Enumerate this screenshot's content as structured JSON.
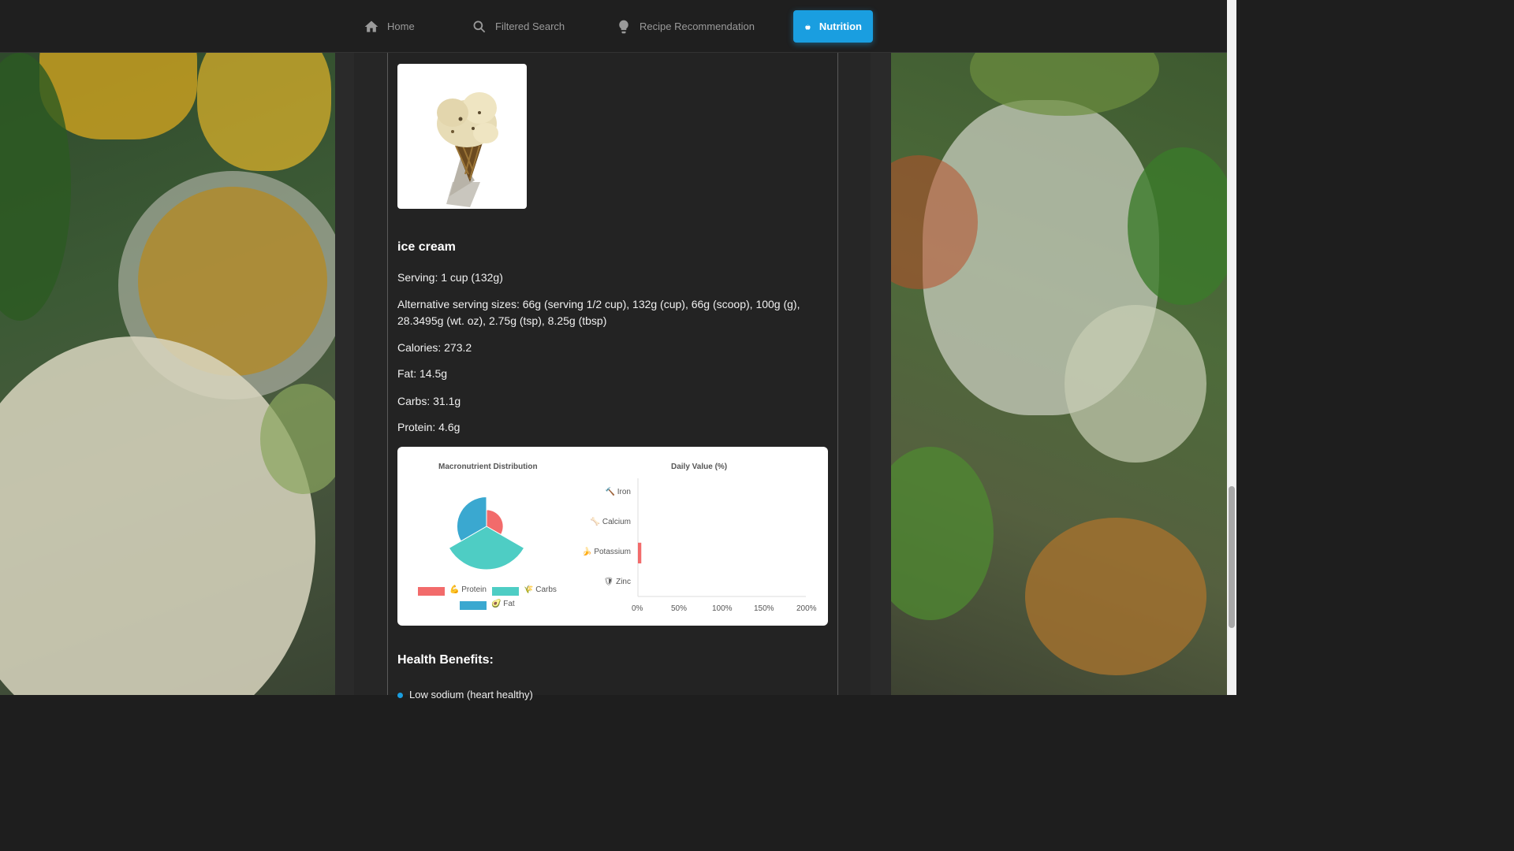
{
  "nav": {
    "items": [
      {
        "label": "Home",
        "icon": "home-icon"
      },
      {
        "label": "Filtered Search",
        "icon": "search-icon"
      },
      {
        "label": "Recipe Recommendation",
        "icon": "lightbulb-icon"
      },
      {
        "label": "Nutrition",
        "icon": "apple-icon",
        "active": true
      }
    ],
    "accent": "#1a9ee0"
  },
  "food": {
    "name": "ice cream",
    "serving": "Serving: 1 cup (132g)",
    "alternative": "Alternative serving sizes: 66g (serving 1/2 cup), 132g (cup), 66g (scoop), 100g (g), 28.3495g (wt. oz), 2.75g (tsp), 8.25g (tbsp)",
    "calories": "Calories: 273.2",
    "fat": "Fat: 14.5g",
    "carbs": "Carbs: 31.1g",
    "protein": "Protein: 4.6g"
  },
  "chart_data": [
    {
      "type": "pie",
      "title": "Macronutrient Distribution",
      "categories": [
        "Protein",
        "Carbs",
        "Fat"
      ],
      "values": [
        4.6,
        31.1,
        14.5
      ],
      "colors": [
        "#f26b6b",
        "#4ecdc4",
        "#3aa8d0"
      ],
      "legend": [
        {
          "label": "Protein",
          "emoji": "💪"
        },
        {
          "label": "Carbs",
          "emoji": "🌾"
        },
        {
          "label": "Fat",
          "emoji": "🥑"
        }
      ]
    },
    {
      "type": "bar",
      "orientation": "horizontal",
      "title": "Daily Value (%)",
      "categories": [
        "Iron",
        "Calcium",
        "Potassium",
        "Zinc"
      ],
      "category_emojis": [
        "🔨",
        "🦴",
        "🍌",
        "🛡"
      ],
      "values": [
        0,
        0,
        4,
        0
      ],
      "xlim": [
        0,
        200
      ],
      "ticks": [
        "0%",
        "50%",
        "100%",
        "150%",
        "200%"
      ],
      "color": "#f26b6b",
      "grid": false
    }
  ],
  "health": {
    "title": "Health Benefits:",
    "items": [
      "Low sodium (heart healthy)"
    ]
  }
}
